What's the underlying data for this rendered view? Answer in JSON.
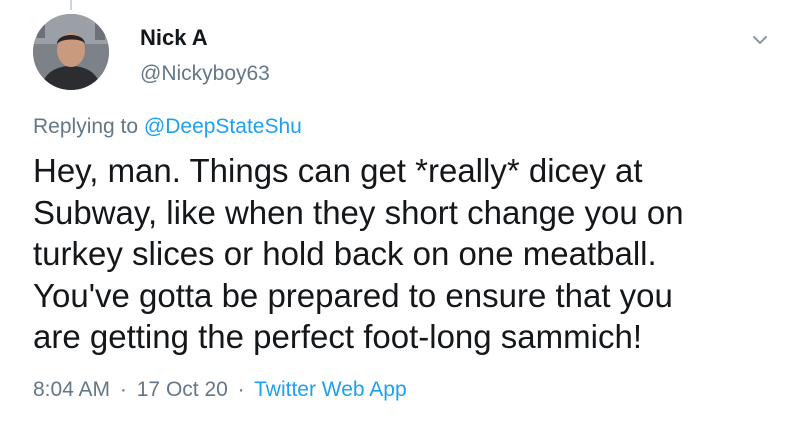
{
  "tweet": {
    "author": {
      "display_name": "Nick A",
      "handle": "@Nickyboy63"
    },
    "replying_prefix": "Replying to",
    "replying_to": "@DeepStateShu",
    "text_lines": [
      "Hey, man.  Things can get *really* dicey at",
      "Subway, like when they short change you on",
      "turkey slices or hold back on one meatball.",
      "You've gotta be prepared to ensure that you",
      "are getting the perfect foot-long sammich!"
    ],
    "time": "8:04 AM",
    "date": "17 Oct 20",
    "separator": "·",
    "source": "Twitter Web App"
  },
  "icons": {
    "menu": "chevron-down-icon",
    "avatar": "profile-photo"
  },
  "colors": {
    "text": "#14171a",
    "secondary": "#657786",
    "link": "#1da1f2"
  }
}
